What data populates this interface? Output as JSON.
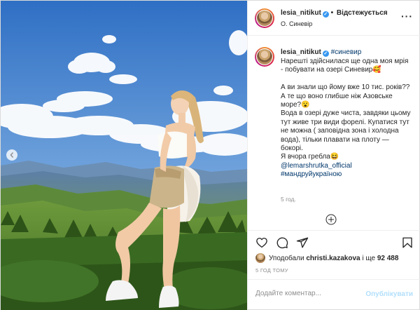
{
  "header": {
    "username": "lesia_nitikut",
    "verified_icon": "verified-badge-icon",
    "separator": "•",
    "follow_label": "Відстежується",
    "location": "О. Синевір",
    "more_icon": "more-options-icon",
    "more_label": "···"
  },
  "caption": {
    "username": "lesia_nitikut",
    "hashtag": "#синевир",
    "paragraphs": [
      "Нарешті здійснилася ще одна моя мрія - побувати на озері Синевир🥰",
      "",
      "А ви знали що йому вже 10 тис. років?? А те що воно глибше ніж Азовське море?😮",
      "Вода в озері дуже чиста, завдяки цьому тут живе три види форелі. Купатися тут не можна ( заповідна зона і холодна вода), тільки плавати на плоту — бокорі.",
      "Я вчора гребла😆"
    ],
    "mention": "@lemarshrutka_official",
    "hashtag2": "#мандруйукраїною",
    "time": "5 год."
  },
  "actions": {
    "like_icon": "heart-icon",
    "comment_icon": "comment-icon",
    "share_icon": "share-icon",
    "save_icon": "bookmark-icon",
    "add_comment_icon": "plus-circle-icon"
  },
  "likes": {
    "prefix": "Уподобали",
    "user": "christi.kazakova",
    "middle": "і ще",
    "count": "92 488"
  },
  "timeago": "5 ГОД ТОМУ",
  "comment": {
    "placeholder": "Додайте коментар...",
    "publish_label": "Опублікувати"
  },
  "photo": {
    "prev_icon": "chevron-left-icon",
    "sky_color": "#4f86cf",
    "accent_link_color": "#00376b"
  }
}
